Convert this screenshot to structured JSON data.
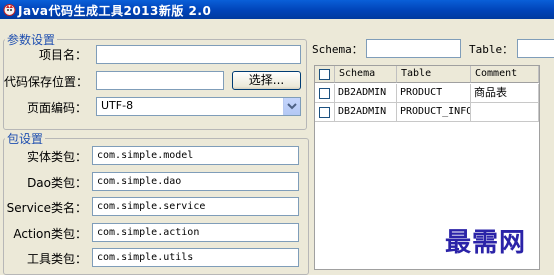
{
  "window": {
    "title": "Java代码生成工具2013新版 2.0"
  },
  "params_group": {
    "legend": "参数设置",
    "project_label": "项目名：",
    "project_value": "",
    "save_path_label": "代码保存位置：",
    "save_path_value": "",
    "browse_label": "选择...",
    "encoding_label": "页面编码：",
    "encoding_value": "UTF-8"
  },
  "package_group": {
    "legend": "包设置",
    "rows": [
      {
        "label": "实体类包：",
        "value": "com.simple.model"
      },
      {
        "label": "Dao类包：",
        "value": "com.simple.dao"
      },
      {
        "label": "Service类名：",
        "value": "com.simple.service"
      },
      {
        "label": "Action类包：",
        "value": "com.simple.action"
      },
      {
        "label": "工具类包：",
        "value": "com.simple.utils"
      }
    ]
  },
  "filter": {
    "schema_label": "Schema：",
    "schema_value": "",
    "table_label": "Table：",
    "table_value": ""
  },
  "table": {
    "headers": [
      "Schema",
      "Table",
      "Comment"
    ],
    "rows": [
      {
        "schema": "DB2ADMIN",
        "table": "PRODUCT",
        "comment": "商品表",
        "checked": false
      },
      {
        "schema": "DB2ADMIN",
        "table": "PRODUCT_INFO",
        "comment": "",
        "checked": false
      }
    ]
  },
  "watermark": "最需网"
}
